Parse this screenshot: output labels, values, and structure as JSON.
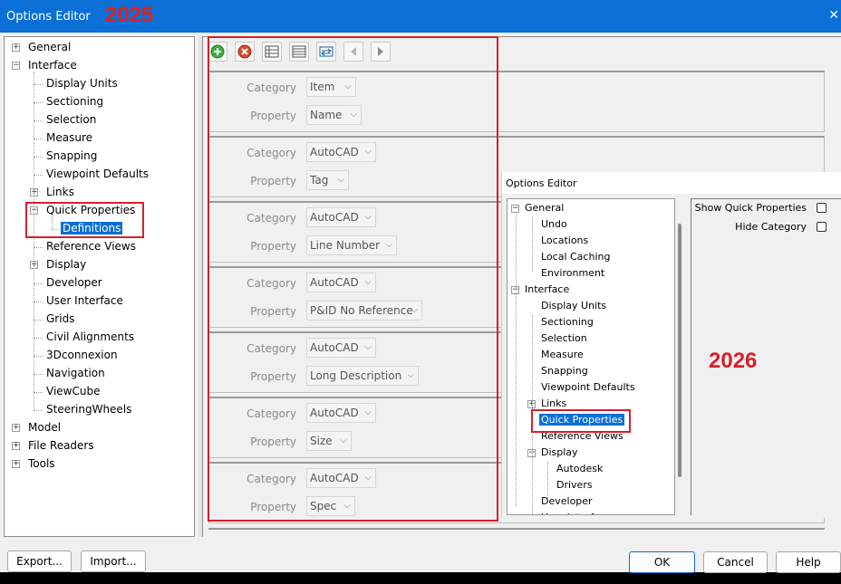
{
  "window": {
    "title": "Options Editor",
    "version_label": "2025",
    "close_glyph": "✕"
  },
  "tree2025": [
    {
      "label": "General",
      "expander": "+"
    },
    {
      "label": "Interface",
      "expander": "−"
    },
    {
      "label": "Display Units"
    },
    {
      "label": "Sectioning"
    },
    {
      "label": "Selection"
    },
    {
      "label": "Measure"
    },
    {
      "label": "Snapping"
    },
    {
      "label": "Viewpoint Defaults"
    },
    {
      "label": "Links",
      "expander": "+"
    },
    {
      "label": "Quick Properties",
      "expander": "−"
    },
    {
      "label": "Definitions",
      "selected": true
    },
    {
      "label": "Reference Views"
    },
    {
      "label": "Display",
      "expander": "+"
    },
    {
      "label": "Developer"
    },
    {
      "label": "User Interface"
    },
    {
      "label": "Grids"
    },
    {
      "label": "Civil Alignments"
    },
    {
      "label": "3Dconnexion"
    },
    {
      "label": "Navigation"
    },
    {
      "label": "ViewCube"
    },
    {
      "label": "SteeringWheels"
    },
    {
      "label": "Model",
      "expander": "+"
    },
    {
      "label": "File Readers",
      "expander": "+"
    },
    {
      "label": "Tools",
      "expander": "+"
    }
  ],
  "toolbar": {
    "icons": [
      "add-icon",
      "delete-icon",
      "expand-rows-icon",
      "collapse-rows-icon",
      "swap-icon",
      "arrow-left-icon",
      "arrow-right-icon"
    ]
  },
  "definitions": {
    "category_label": "Category",
    "property_label": "Property",
    "rows": [
      {
        "category": "Item",
        "property": "Name"
      },
      {
        "category": "AutoCAD",
        "property": "Tag"
      },
      {
        "category": "AutoCAD",
        "property": "Line Number"
      },
      {
        "category": "AutoCAD",
        "property": "P&ID No Reference"
      },
      {
        "category": "AutoCAD",
        "property": "Long Description"
      },
      {
        "category": "AutoCAD",
        "property": "Size"
      },
      {
        "category": "AutoCAD",
        "property": "Spec"
      }
    ]
  },
  "overlay2026": {
    "title": "Options Editor",
    "version_label": "2026",
    "tree": [
      {
        "label": "General",
        "expander": "−"
      },
      {
        "label": "Undo"
      },
      {
        "label": "Locations"
      },
      {
        "label": "Local Caching"
      },
      {
        "label": "Environment"
      },
      {
        "label": "Interface",
        "expander": "−"
      },
      {
        "label": "Display Units"
      },
      {
        "label": "Sectioning"
      },
      {
        "label": "Selection"
      },
      {
        "label": "Measure"
      },
      {
        "label": "Snapping"
      },
      {
        "label": "Viewpoint Defaults"
      },
      {
        "label": "Links",
        "expander": "+"
      },
      {
        "label": "Quick Properties",
        "selected": true
      },
      {
        "label": "Reference Views"
      },
      {
        "label": "Display",
        "expander": "−"
      },
      {
        "label": "Autodesk"
      },
      {
        "label": "Drivers"
      },
      {
        "label": "Developer"
      },
      {
        "label": "User Interface"
      }
    ],
    "options": [
      {
        "label": "Show Quick Properties",
        "checked": false
      },
      {
        "label": "Hide Category",
        "checked": false
      }
    ]
  },
  "buttons": {
    "export": "Export...",
    "import": "Import...",
    "ok": "OK",
    "cancel": "Cancel",
    "help": "Help"
  },
  "colors": {
    "accent": "#0a6fd6",
    "annotation_red": "#d4202c"
  }
}
